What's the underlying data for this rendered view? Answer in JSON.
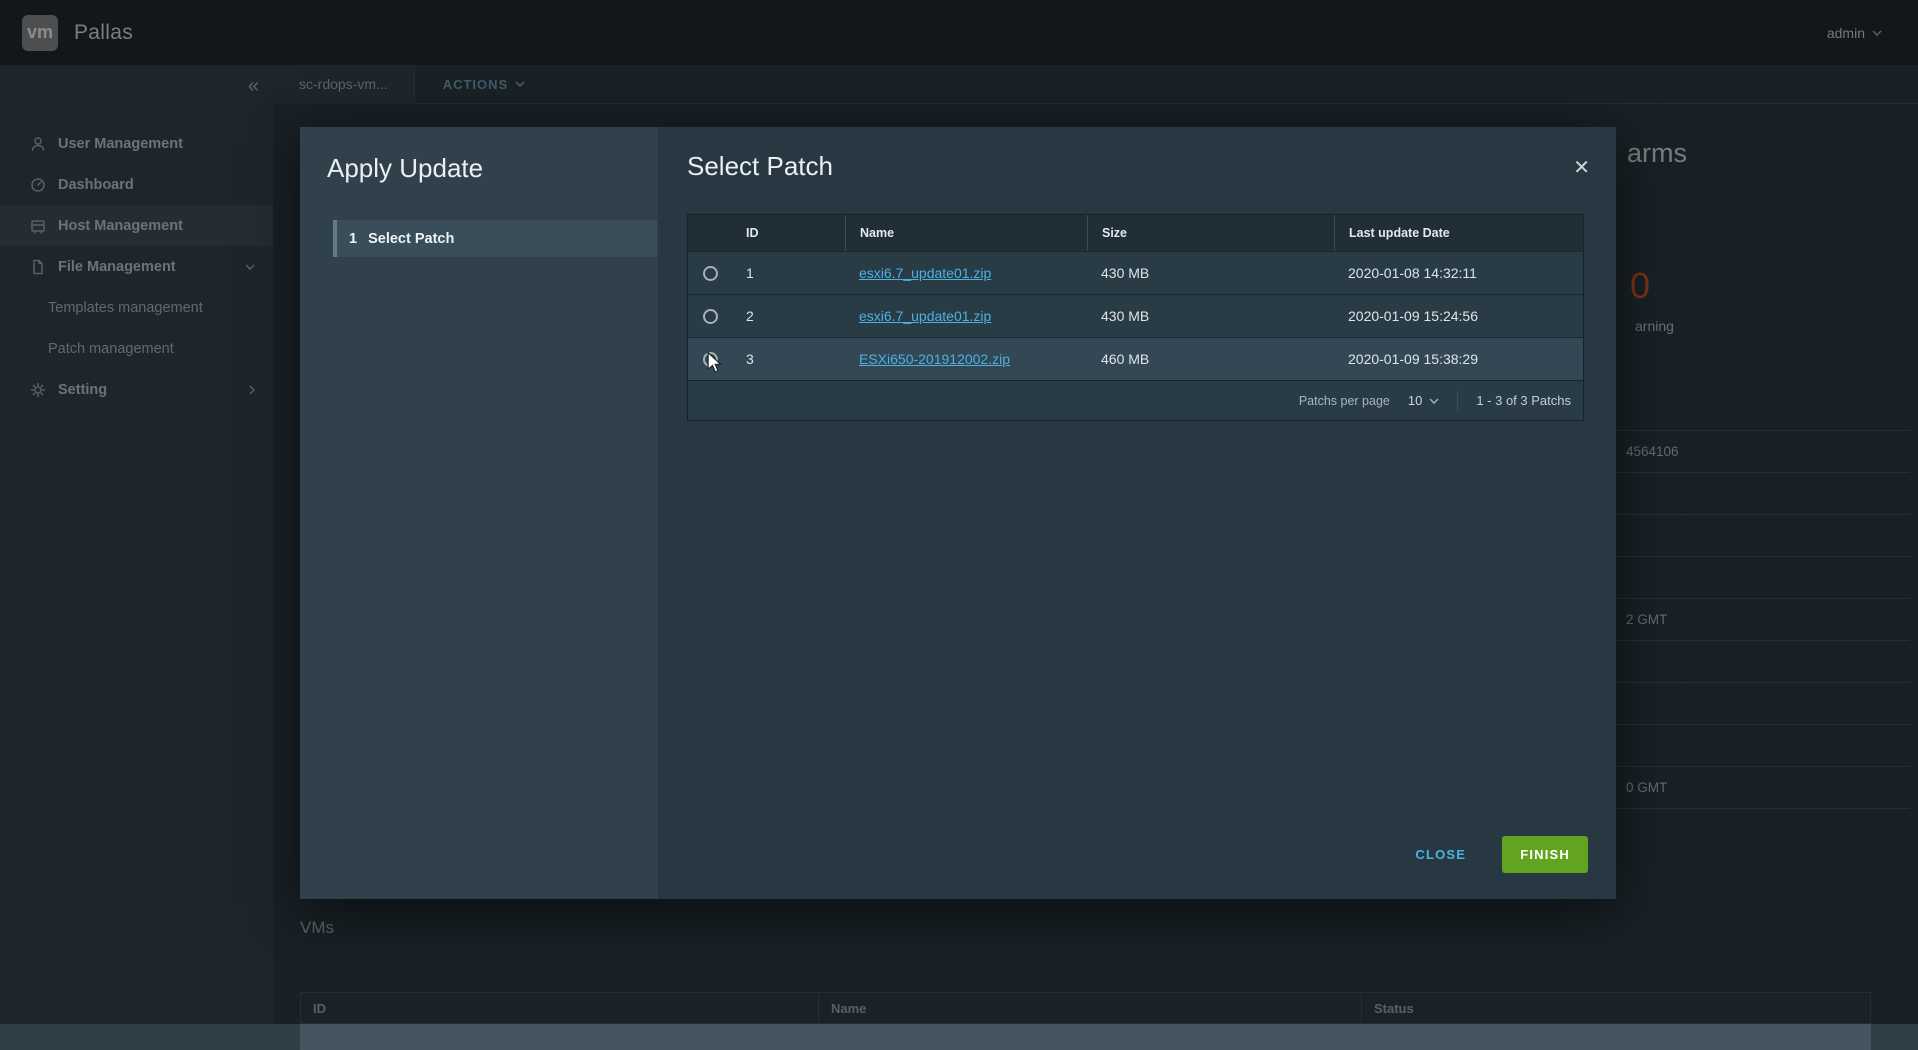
{
  "topbar": {
    "logo": "vm",
    "title": "Pallas",
    "user": "admin"
  },
  "tabbar": {
    "tab": "sc-rdops-vm...",
    "actions": "ACTIONS"
  },
  "sidebar": {
    "items": [
      {
        "label": "User Management"
      },
      {
        "label": "Dashboard"
      },
      {
        "label": "Host Management"
      },
      {
        "label": "File Management"
      },
      {
        "label": "Templates management"
      },
      {
        "label": "Patch management"
      },
      {
        "label": "Setting"
      }
    ]
  },
  "modal": {
    "left_title": "Apply Update",
    "step_number": "1",
    "step_label": "Select Patch",
    "title": "Select Patch",
    "table": {
      "headers": {
        "id": "ID",
        "name": "Name",
        "size": "Size",
        "date": "Last update Date"
      },
      "rows": [
        {
          "id": "1",
          "name": "esxi6.7_update01.zip",
          "size": "430 MB",
          "date": "2020-01-08 14:32:11"
        },
        {
          "id": "2",
          "name": "esxi6.7_update01.zip",
          "size": "430 MB",
          "date": "2020-01-09 15:24:56"
        },
        {
          "id": "3",
          "name": "ESXi650-201912002.zip",
          "size": "460 MB",
          "date": "2020-01-09 15:38:29"
        }
      ],
      "footer": {
        "per_page_label": "Patchs per page",
        "per_page_value": "10",
        "range": "1 - 3 of 3 Patchs"
      }
    },
    "buttons": {
      "close": "CLOSE",
      "finish": "FINISH"
    }
  },
  "background": {
    "alarms_fragment": "arms",
    "warning_count": "0",
    "warning_fragment": "arning",
    "right_rows": [
      "4564106",
      "",
      "",
      "",
      "2 GMT",
      "",
      "",
      "",
      "0 GMT"
    ],
    "vms": {
      "title": "VMs",
      "headers": {
        "id": "ID",
        "name": "Name",
        "status": "Status"
      }
    }
  },
  "icons": {
    "close_glyph": "✕",
    "collapse_glyph": "«"
  },
  "colors": {
    "accent_blue": "#4db1e2",
    "success_green": "#62a420",
    "warning_orange": "#e0592a"
  }
}
